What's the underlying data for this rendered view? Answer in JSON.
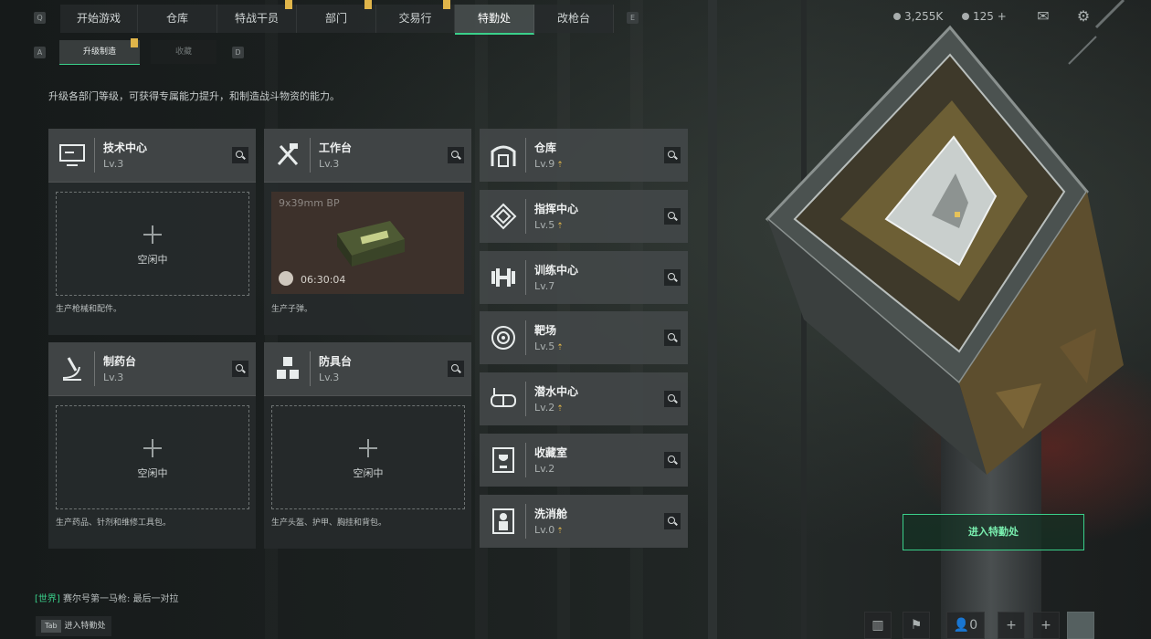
{
  "nav": {
    "left_key": "Q",
    "right_key": "E",
    "tabs": [
      {
        "label": "开始游戏",
        "badge": false
      },
      {
        "label": "仓库",
        "badge": false
      },
      {
        "label": "特战干员",
        "badge": true
      },
      {
        "label": "部门",
        "badge": true
      },
      {
        "label": "交易行",
        "badge": true
      },
      {
        "label": "特勤处",
        "badge": false,
        "active": true
      },
      {
        "label": "改枪台",
        "badge": false
      }
    ],
    "currency": "3,255K",
    "tokens": "125",
    "tokens_add": "+"
  },
  "subnav": {
    "left_key": "A",
    "right_key": "D",
    "tabs": [
      {
        "label": "升级制造",
        "active": true
      },
      {
        "label": "收藏",
        "active": false
      }
    ]
  },
  "description": "升级各部门等级，可获得专属能力提升，和制造战斗物资的能力。",
  "panels": [
    {
      "name": "技术中心",
      "level": "Lv.3",
      "status": "空闲中",
      "footer": "生产枪械和配件。"
    },
    {
      "name": "工作台",
      "level": "Lv.3",
      "footer": "生产子弹。",
      "production": {
        "item": "9x39mm BP",
        "time": "06:30:04"
      }
    },
    {
      "name": "制药台",
      "level": "Lv.3",
      "status": "空闲中",
      "footer": "生产药品、针剂和维修工具包。"
    },
    {
      "name": "防具台",
      "level": "Lv.3",
      "status": "空闲中",
      "footer": "生产头盔、护甲、胸挂和背包。"
    }
  ],
  "facilities": [
    {
      "name": "仓库",
      "level": "Lv.9",
      "upgrade": true
    },
    {
      "name": "指挥中心",
      "level": "Lv.5",
      "upgrade": true
    },
    {
      "name": "训练中心",
      "level": "Lv.7",
      "upgrade": false
    },
    {
      "name": "靶场",
      "level": "Lv.5",
      "upgrade": true
    },
    {
      "name": "潜水中心",
      "level": "Lv.2",
      "upgrade": true
    },
    {
      "name": "收藏室",
      "level": "Lv.2",
      "upgrade": false
    },
    {
      "name": "洗消舱",
      "level": "Lv.0",
      "upgrade": true
    }
  ],
  "enter_button": "进入特勤处",
  "chat": {
    "channel": "[世界]",
    "sender": "赛尔号第一马枪:",
    "message": "最后一对拉"
  },
  "bottom_hint": {
    "key": "Tab",
    "label": "进入特勤处"
  },
  "friends_count": "0",
  "colors": {
    "accent": "#3ad08a",
    "badge": "#e0b54a"
  }
}
